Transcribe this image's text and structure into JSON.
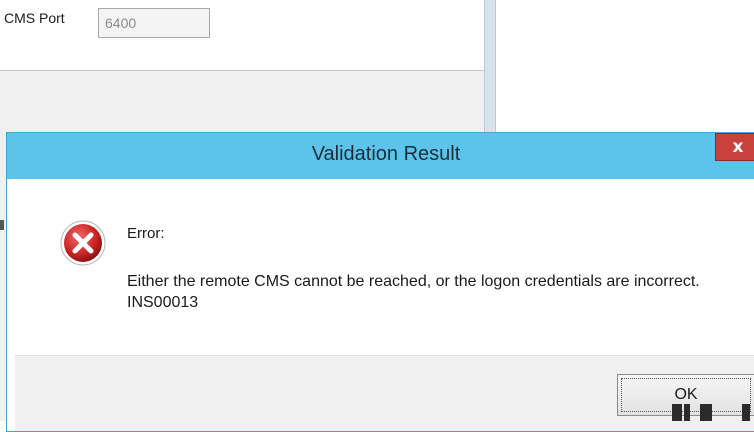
{
  "background_window": {
    "cms_port_label": "CMS Port",
    "cms_port_value": "6400"
  },
  "dialog": {
    "title": "Validation Result",
    "close_label": "x",
    "error_title": "Error:",
    "error_message": "Either the remote CMS cannot be reached, or the logon credentials are incorrect. INS00013",
    "ok_label": "OK",
    "icon": "error-icon"
  },
  "colors": {
    "titlebar": "#5cc4eb",
    "close_button": "#c9413c",
    "error_icon": "#cc2a2a"
  }
}
